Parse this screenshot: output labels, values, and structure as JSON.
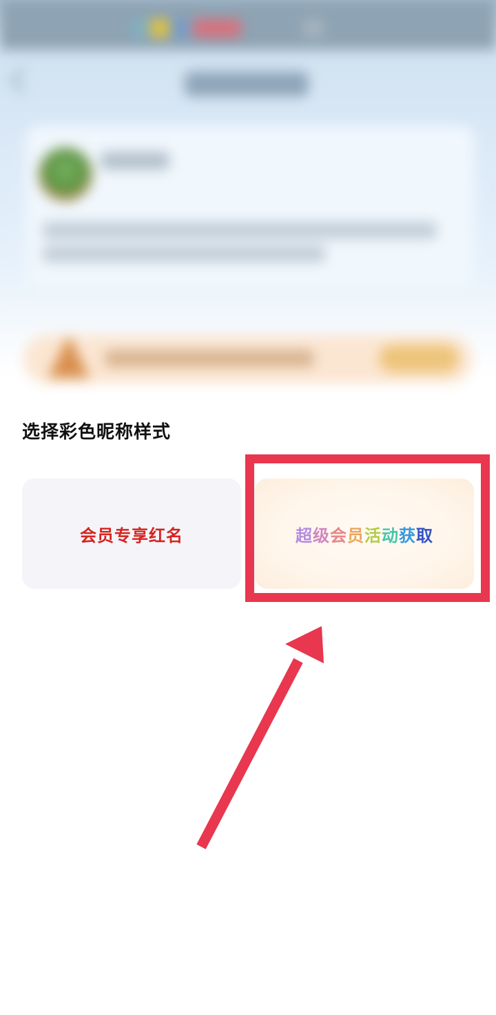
{
  "section": {
    "title": "选择彩色昵称样式"
  },
  "options": [
    {
      "label": "会员专享红名",
      "color": "#d6221e"
    },
    {
      "label": "超级会员活动获取",
      "chars": [
        "超",
        "级",
        "会",
        "员",
        "活",
        "动",
        "获",
        "取"
      ],
      "char_colors": [
        "#b48adf",
        "#cf86c0",
        "#e98585",
        "#eda55a",
        "#b3cc45",
        "#44c6a8",
        "#3597df",
        "#3552c6"
      ]
    }
  ],
  "annotation": {
    "color": "#e8374e"
  }
}
